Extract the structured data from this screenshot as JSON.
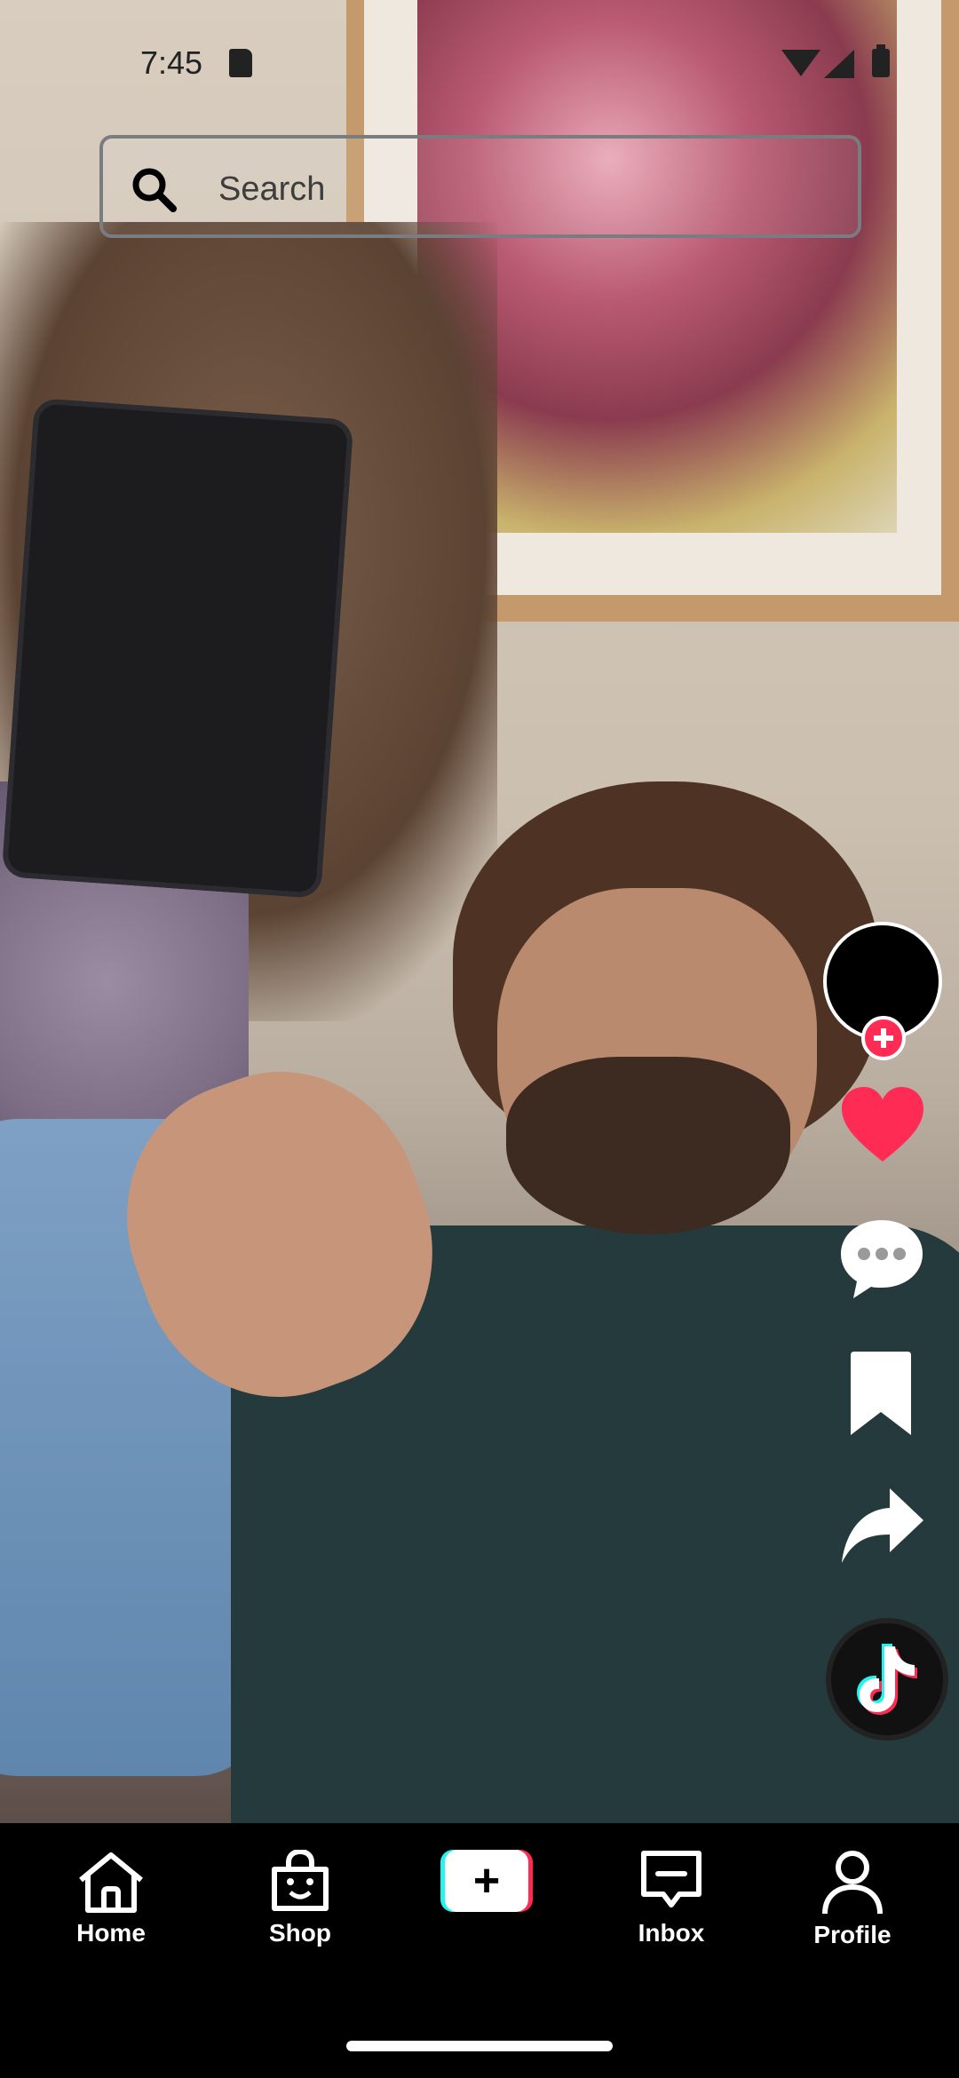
{
  "status_bar": {
    "time": "7:45"
  },
  "search": {
    "placeholder": "Search"
  },
  "actions": {
    "avatar_icon": "profile-avatar",
    "follow_icon": "plus-icon",
    "like_icon": "heart-icon",
    "like_color": "#fe2c55",
    "comment_icon": "comment-icon",
    "bookmark_icon": "bookmark-icon",
    "share_icon": "share-icon",
    "music_icon": "tiktok-logo-icon"
  },
  "bottom_nav": {
    "items": [
      {
        "label": "Home",
        "icon": "home-icon"
      },
      {
        "label": "Shop",
        "icon": "shopping-bag-icon"
      },
      {
        "label": "",
        "icon": "create-plus-icon"
      },
      {
        "label": "Inbox",
        "icon": "inbox-icon"
      },
      {
        "label": "Profile",
        "icon": "person-icon"
      }
    ]
  },
  "colors": {
    "accent_red": "#fe2c55",
    "accent_cyan": "#25f4ee",
    "nav_background": "#000000"
  }
}
